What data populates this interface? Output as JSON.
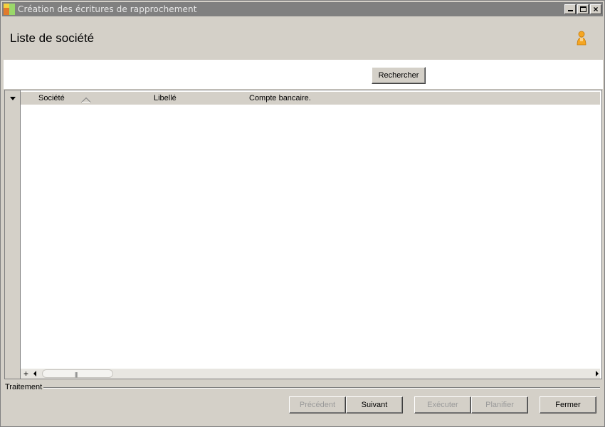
{
  "window": {
    "title": "Création des écritures de rapprochement"
  },
  "header": {
    "title": "Liste de société"
  },
  "search": {
    "button_label": "Rechercher"
  },
  "grid": {
    "columns": [
      "Société",
      "Libellé",
      "Compte bancaire."
    ],
    "sorted_column": "Société",
    "sort_direction": "ascending",
    "add_label": "+",
    "thumb_grip": "|||"
  },
  "footer": {
    "section_label": "Traitement",
    "buttons": {
      "previous": "Précédent",
      "next": "Suivant",
      "execute": "Exécuter",
      "schedule": "Planifier",
      "close": "Fermer"
    }
  },
  "icons": {
    "app": "app-logo-icon",
    "user": "user-icon",
    "sort": "sort-ascending-icon"
  },
  "colors": {
    "titlebar": "#808080",
    "face": "#d4d0c8",
    "disabled_text": "#9a9a9a",
    "user_icon": "#f5a623"
  }
}
